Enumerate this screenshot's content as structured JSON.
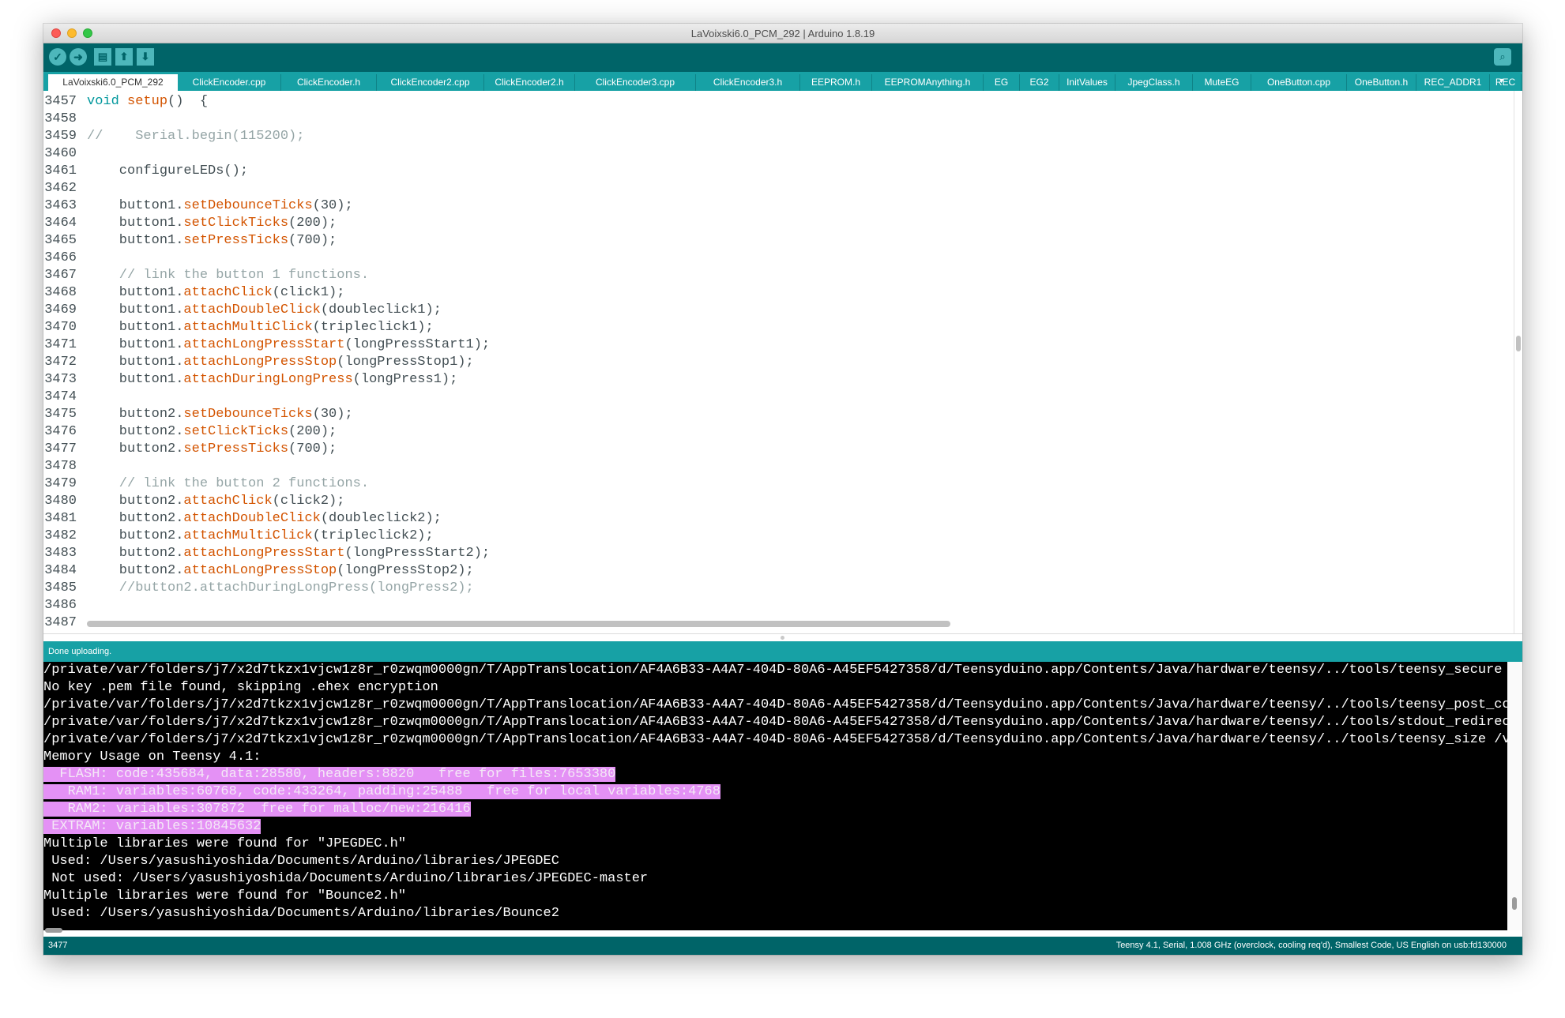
{
  "window": {
    "title": "LaVoixski6.0_PCM_292 | Arduino 1.8.19"
  },
  "toolbar": {
    "verify_icon": "check-icon",
    "upload_icon": "arrow-right-icon",
    "new_icon": "new-file-icon",
    "open_icon": "arrow-up-icon",
    "save_icon": "arrow-down-icon",
    "serial_monitor_icon": "magnifier-icon",
    "accent_color": "#006468",
    "button_color": "#4db7bb"
  },
  "tabs": [
    {
      "label": "LaVoixski6.0_PCM_292",
      "active": true
    },
    {
      "label": "ClickEncoder.cpp"
    },
    {
      "label": "ClickEncoder.h"
    },
    {
      "label": "ClickEncoder2.cpp"
    },
    {
      "label": "ClickEncoder2.h"
    },
    {
      "label": "ClickEncoder3.cpp"
    },
    {
      "label": "ClickEncoder3.h"
    },
    {
      "label": "EEPROM.h"
    },
    {
      "label": "EEPROMAnything.h"
    },
    {
      "label": "EG"
    },
    {
      "label": "EG2"
    },
    {
      "label": "InitValues"
    },
    {
      "label": "JpegClass.h"
    },
    {
      "label": "MuteEG"
    },
    {
      "label": "OneButton.cpp"
    },
    {
      "label": "OneButton.h"
    },
    {
      "label": "REC_ADDR1"
    },
    {
      "label": "REC"
    }
  ],
  "tab_more_icon": "triangle-down-icon",
  "code": [
    {
      "n": "3457",
      "parts": [
        [
          "kw",
          "void"
        ],
        [
          "",
          ""
        ],
        [
          "fn",
          " setup"
        ],
        [
          "",
          "()  {"
        ]
      ]
    },
    {
      "n": "3458",
      "parts": []
    },
    {
      "n": "3459",
      "parts": [
        [
          "cm",
          "//    Serial.begin(115200);"
        ]
      ]
    },
    {
      "n": "3460",
      "parts": []
    },
    {
      "n": "3461",
      "parts": [
        [
          "",
          "    configureLEDs();"
        ]
      ]
    },
    {
      "n": "3462",
      "parts": []
    },
    {
      "n": "3463",
      "parts": [
        [
          "",
          "    button1."
        ],
        [
          "fn",
          "setDebounceTicks"
        ],
        [
          "",
          "(30);"
        ]
      ]
    },
    {
      "n": "3464",
      "parts": [
        [
          "",
          "    button1."
        ],
        [
          "fn",
          "setClickTicks"
        ],
        [
          "",
          "(200);"
        ]
      ]
    },
    {
      "n": "3465",
      "parts": [
        [
          "",
          "    button1."
        ],
        [
          "fn",
          "setPressTicks"
        ],
        [
          "",
          "(700);"
        ]
      ]
    },
    {
      "n": "3466",
      "parts": []
    },
    {
      "n": "3467",
      "parts": [
        [
          "cm",
          "    // link the button 1 functions."
        ]
      ]
    },
    {
      "n": "3468",
      "parts": [
        [
          "",
          "    button1."
        ],
        [
          "fn",
          "attachClick"
        ],
        [
          "",
          "(click1);"
        ]
      ]
    },
    {
      "n": "3469",
      "parts": [
        [
          "",
          "    button1."
        ],
        [
          "fn",
          "attachDoubleClick"
        ],
        [
          "",
          "(doubleclick1);"
        ]
      ]
    },
    {
      "n": "3470",
      "parts": [
        [
          "",
          "    button1."
        ],
        [
          "fn",
          "attachMultiClick"
        ],
        [
          "",
          "(tripleclick1);"
        ]
      ]
    },
    {
      "n": "3471",
      "parts": [
        [
          "",
          "    button1."
        ],
        [
          "fn",
          "attachLongPressStart"
        ],
        [
          "",
          "(longPressStart1);"
        ]
      ]
    },
    {
      "n": "3472",
      "parts": [
        [
          "",
          "    button1."
        ],
        [
          "fn",
          "attachLongPressStop"
        ],
        [
          "",
          "(longPressStop1);"
        ]
      ]
    },
    {
      "n": "3473",
      "parts": [
        [
          "",
          "    button1."
        ],
        [
          "fn",
          "attachDuringLongPress"
        ],
        [
          "",
          "(longPress1);"
        ]
      ]
    },
    {
      "n": "3474",
      "parts": []
    },
    {
      "n": "3475",
      "parts": [
        [
          "",
          "    button2."
        ],
        [
          "fn",
          "setDebounceTicks"
        ],
        [
          "",
          "(30);"
        ]
      ]
    },
    {
      "n": "3476",
      "parts": [
        [
          "",
          "    button2."
        ],
        [
          "fn",
          "setClickTicks"
        ],
        [
          "",
          "(200);"
        ]
      ]
    },
    {
      "n": "3477",
      "parts": [
        [
          "",
          "    button2."
        ],
        [
          "fn",
          "setPressTicks"
        ],
        [
          "",
          "(700);"
        ]
      ]
    },
    {
      "n": "3478",
      "parts": []
    },
    {
      "n": "3479",
      "parts": [
        [
          "cm",
          "    // link the button 2 functions."
        ]
      ]
    },
    {
      "n": "3480",
      "parts": [
        [
          "",
          "    button2."
        ],
        [
          "fn",
          "attachClick"
        ],
        [
          "",
          "(click2);"
        ]
      ]
    },
    {
      "n": "3481",
      "parts": [
        [
          "",
          "    button2."
        ],
        [
          "fn",
          "attachDoubleClick"
        ],
        [
          "",
          "(doubleclick2);"
        ]
      ]
    },
    {
      "n": "3482",
      "parts": [
        [
          "",
          "    button2."
        ],
        [
          "fn",
          "attachMultiClick"
        ],
        [
          "",
          "(tripleclick2);"
        ]
      ]
    },
    {
      "n": "3483",
      "parts": [
        [
          "",
          "    button2."
        ],
        [
          "fn",
          "attachLongPressStart"
        ],
        [
          "",
          "(longPressStart2);"
        ]
      ]
    },
    {
      "n": "3484",
      "parts": [
        [
          "",
          "    button2."
        ],
        [
          "fn",
          "attachLongPressStop"
        ],
        [
          "",
          "(longPressStop2);"
        ]
      ]
    },
    {
      "n": "3485",
      "parts": [
        [
          "cm",
          "    //button2.attachDuringLongPress(longPress2);"
        ]
      ]
    },
    {
      "n": "3486",
      "parts": []
    },
    {
      "n": "3487",
      "parts": []
    }
  ],
  "status": {
    "message": "Done uploading."
  },
  "console": [
    {
      "text": "/private/var/folders/j7/x2d7tkzx1vjcw1z8r_r0zwqm0000gn/T/AppTranslocation/AF4A6B33-A4A7-404D-80A6-A45EF5427358/d/Teensyduino.app/Contents/Java/hardware/teensy/../tools/teensy_secure encr",
      "hl": false
    },
    {
      "text": "No key .pem file found, skipping .ehex encryption",
      "hl": false
    },
    {
      "text": "/private/var/folders/j7/x2d7tkzx1vjcw1z8r_r0zwqm0000gn/T/AppTranslocation/AF4A6B33-A4A7-404D-80A6-A45EF5427358/d/Teensyduino.app/Contents/Java/hardware/teensy/../tools/teensy_post_compil",
      "hl": false
    },
    {
      "text": "/private/var/folders/j7/x2d7tkzx1vjcw1z8r_r0zwqm0000gn/T/AppTranslocation/AF4A6B33-A4A7-404D-80A6-A45EF5427358/d/Teensyduino.app/Contents/Java/hardware/teensy/../tools/stdout_redirect /v",
      "hl": false
    },
    {
      "text": "/private/var/folders/j7/x2d7tkzx1vjcw1z8r_r0zwqm0000gn/T/AppTranslocation/AF4A6B33-A4A7-404D-80A6-A45EF5427358/d/Teensyduino.app/Contents/Java/hardware/teensy/../tools/teensy_size /var/f",
      "hl": false
    },
    {
      "text": "Memory Usage on Teensy 4.1:",
      "hl": false
    },
    {
      "text": "  FLASH: code:435684, data:28580, headers:8820   free for files:7653380",
      "hl": true
    },
    {
      "text": "   RAM1: variables:60768, code:433264, padding:25488   free for local variables:4768",
      "hl": true
    },
    {
      "text": "   RAM2: variables:307872  free for malloc/new:216416",
      "hl": true
    },
    {
      "text": " EXTRAM: variables:10845632",
      "hl": true
    },
    {
      "text": "Multiple libraries were found for \"JPEGDEC.h\"",
      "hl": false
    },
    {
      "text": " Used: /Users/yasushiyoshida/Documents/Arduino/libraries/JPEGDEC",
      "hl": false
    },
    {
      "text": " Not used: /Users/yasushiyoshida/Documents/Arduino/libraries/JPEGDEC-master",
      "hl": false
    },
    {
      "text": "Multiple libraries were found for \"Bounce2.h\"",
      "hl": false
    },
    {
      "text": " Used: /Users/yasushiyoshida/Documents/Arduino/libraries/Bounce2",
      "hl": false
    }
  ],
  "footer": {
    "line_number": "3477",
    "board": "Teensy 4.1, Serial, 1.008 GHz (overclock, cooling req'd), Smallest Code, US English on usb:fd130000"
  }
}
